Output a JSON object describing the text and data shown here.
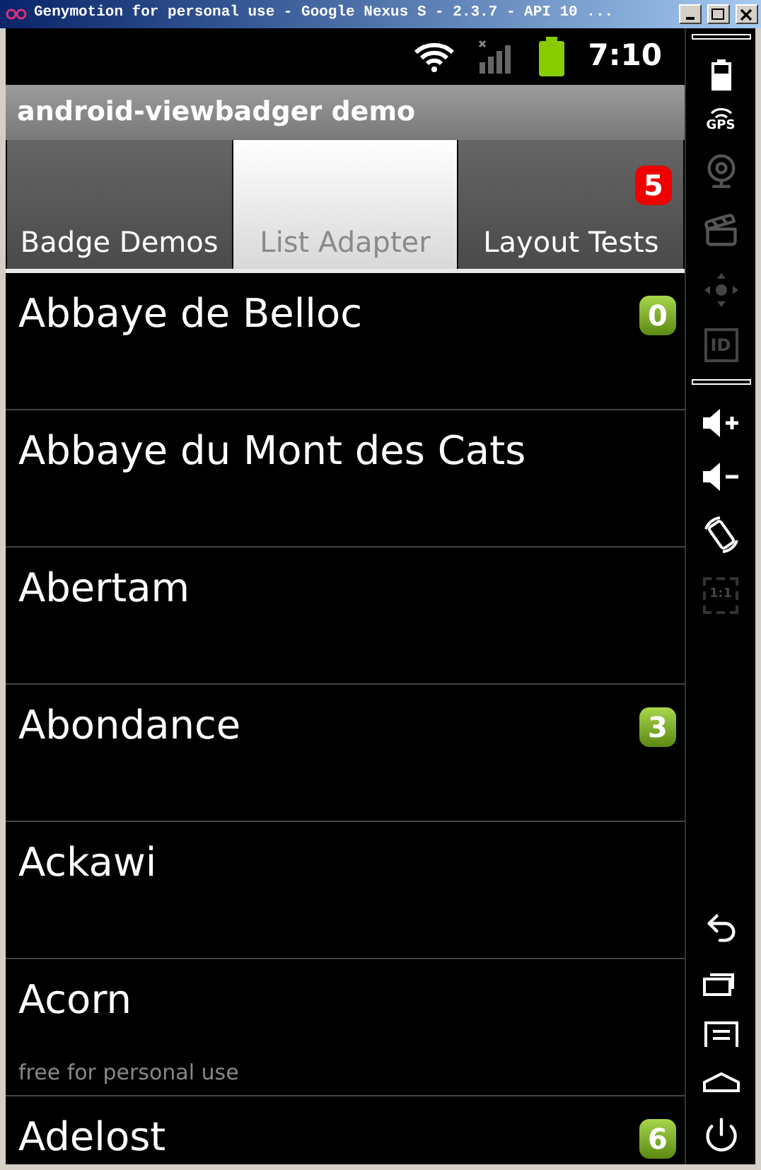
{
  "window": {
    "title": "Genymotion for personal use - Google Nexus S - 2.3.7 - API 10 ..."
  },
  "status_bar": {
    "time": "7:10"
  },
  "action_bar": {
    "title": "android-viewbadger demo"
  },
  "tabs": [
    {
      "label": "Badge Demos",
      "selected": false
    },
    {
      "label": "List Adapter",
      "selected": true
    },
    {
      "label": "Layout Tests",
      "selected": false,
      "badge": "5"
    }
  ],
  "list": [
    {
      "name": "Abbaye de Belloc",
      "badge": "0"
    },
    {
      "name": "Abbaye du Mont des Cats"
    },
    {
      "name": "Abertam"
    },
    {
      "name": "Abondance",
      "badge": "3"
    },
    {
      "name": "Ackawi"
    },
    {
      "name": "Acorn"
    },
    {
      "name": "Adelost",
      "badge": "6"
    }
  ],
  "overlay": {
    "text": "free for personal use"
  },
  "side_panel": {
    "gps_label": "GPS",
    "id_label": "ID",
    "scale_label": "1:1"
  }
}
